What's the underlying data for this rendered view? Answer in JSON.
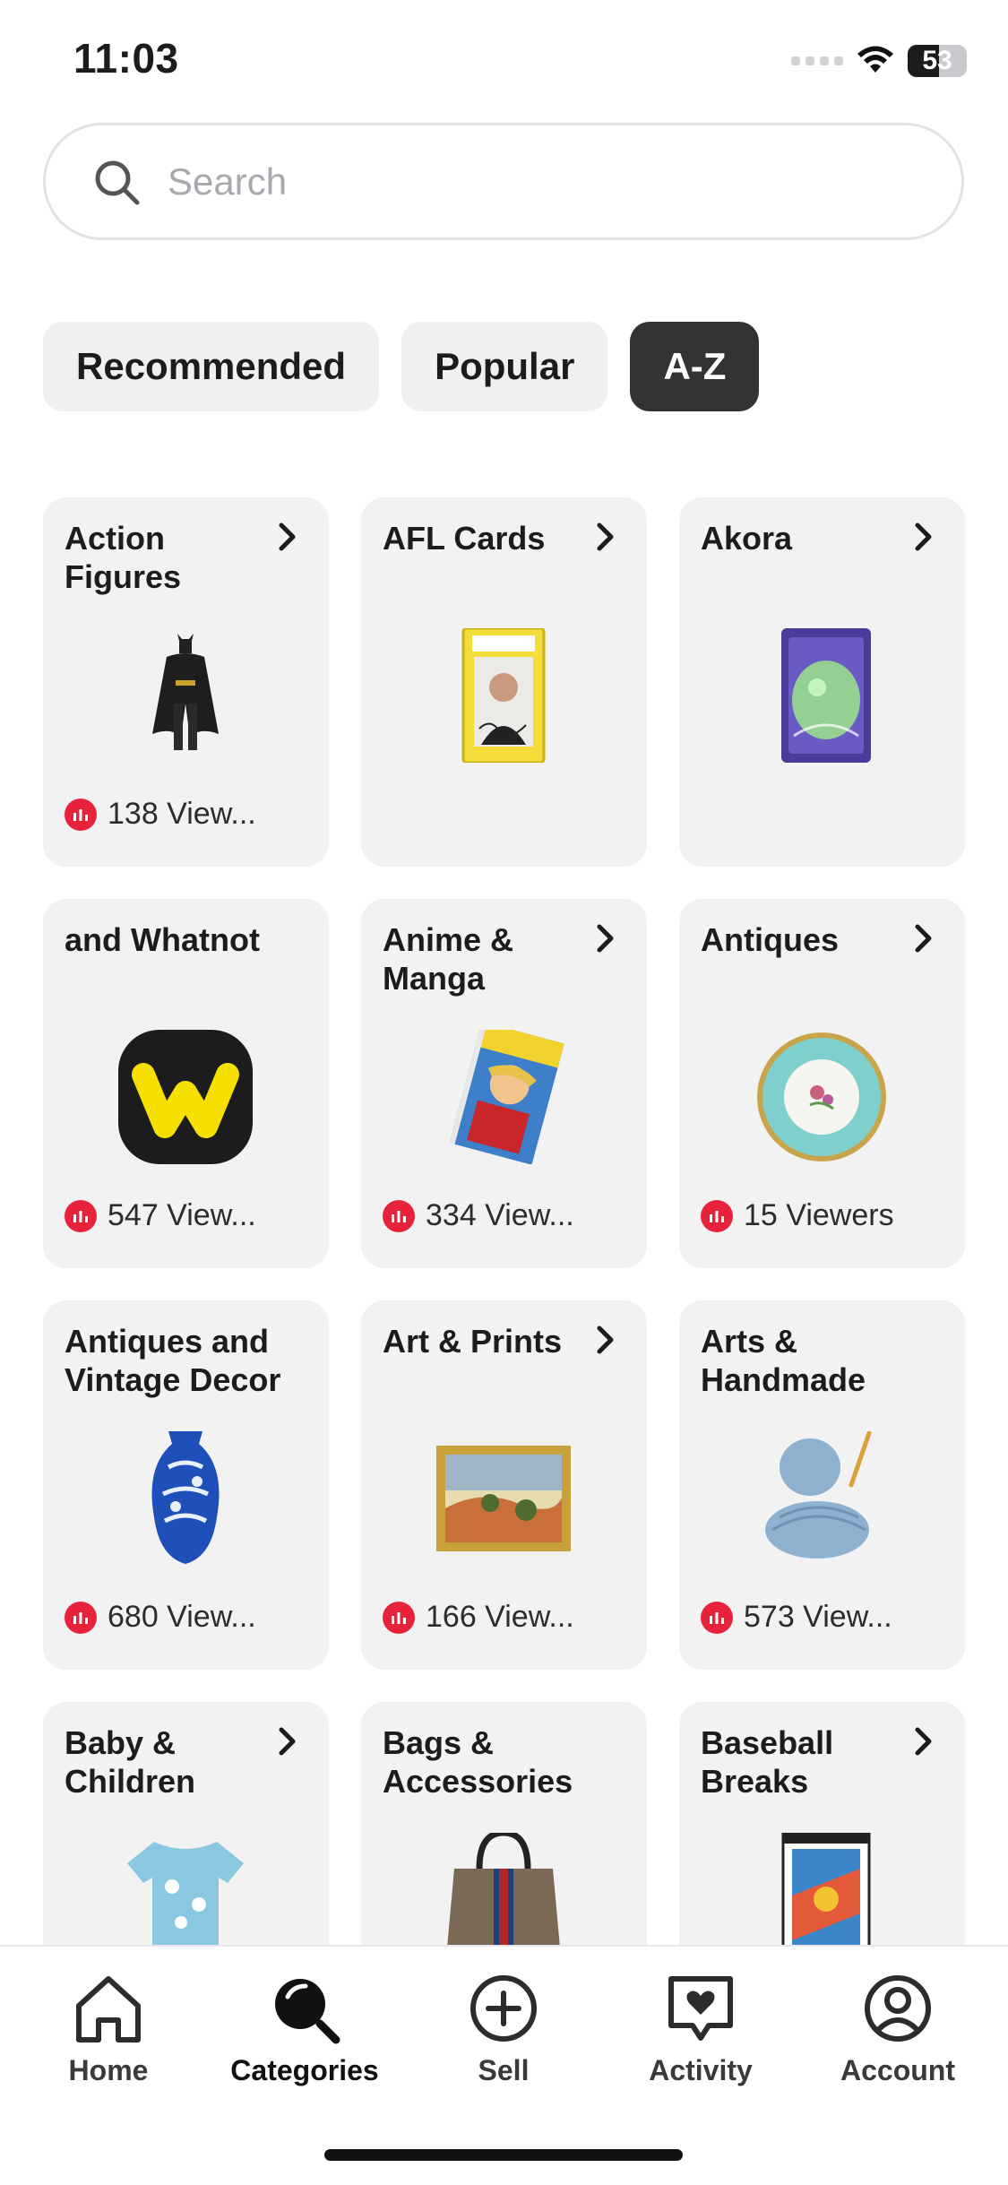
{
  "status_bar": {
    "time": "11:03",
    "battery": "53"
  },
  "search": {
    "placeholder": "Search",
    "value": ""
  },
  "tabs": [
    {
      "label": "Recommended",
      "active": false
    },
    {
      "label": "Popular",
      "active": false
    },
    {
      "label": "A-Z",
      "active": true
    }
  ],
  "categories": [
    {
      "title": "Action Figures",
      "viewers": "138 View..."
    },
    {
      "title": "AFL Cards",
      "viewers": ""
    },
    {
      "title": "Akora",
      "viewers": ""
    },
    {
      "title": "and Whatnot",
      "viewers": "547 View..."
    },
    {
      "title": "Anime & Manga",
      "viewers": "334 View..."
    },
    {
      "title": "Antiques",
      "viewers": "15 Viewers"
    },
    {
      "title": "Antiques and Vintage Decor",
      "viewers": "680 View..."
    },
    {
      "title": "Art & Prints",
      "viewers": "166 View..."
    },
    {
      "title": "Arts & Handmade",
      "viewers": "573 View..."
    },
    {
      "title": "Baby & Children",
      "viewers": ""
    },
    {
      "title": "Bags & Accessories",
      "viewers": ""
    },
    {
      "title": "Baseball Breaks",
      "viewers": ""
    }
  ],
  "tab_bar": [
    {
      "label": "Home",
      "icon": "home-icon",
      "active": false
    },
    {
      "label": "Categories",
      "icon": "categories-search-icon",
      "active": true
    },
    {
      "label": "Sell",
      "icon": "plus-circle-icon",
      "active": false
    },
    {
      "label": "Activity",
      "icon": "heart-message-icon",
      "active": false
    },
    {
      "label": "Account",
      "icon": "user-circle-icon",
      "active": false
    }
  ],
  "colors": {
    "live_red": "#e6233b",
    "active_tab": "#333335",
    "card_bg": "#f2f2f3"
  }
}
